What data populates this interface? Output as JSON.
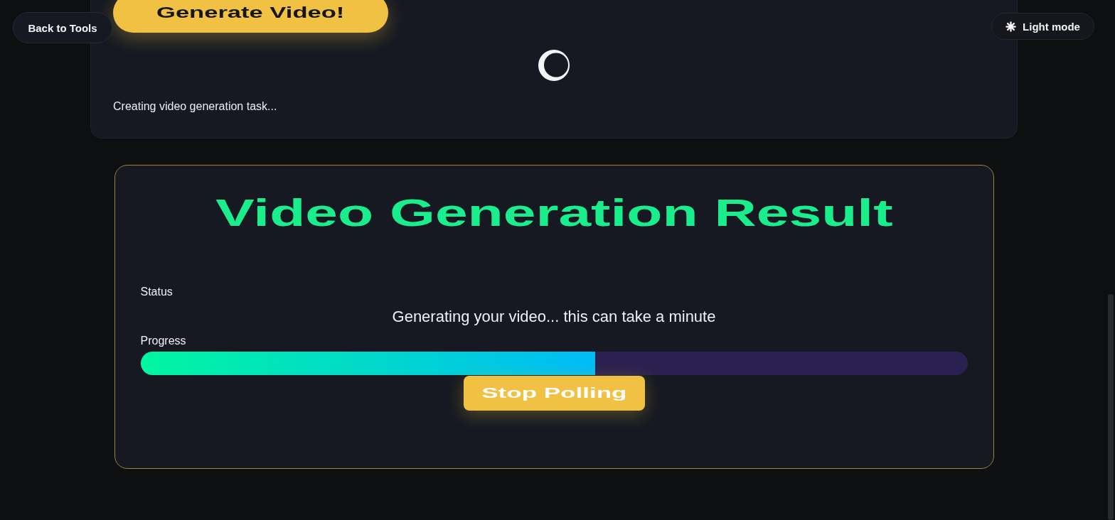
{
  "top_bar": {
    "back_button": "Back to Tools",
    "theme_toggle": {
      "label": "Light mode"
    }
  },
  "generator_card": {
    "generate_button": "Generate Video!",
    "loading": true,
    "status_text": "Creating video generation task..."
  },
  "result_card": {
    "title": "Video Generation Result",
    "status_label": "Status",
    "status_message": "Generating your video... this can take a minute",
    "progress_label": "Progress",
    "progress": {
      "level": 0.55
    },
    "stop_button": "Stop Polling"
  }
}
